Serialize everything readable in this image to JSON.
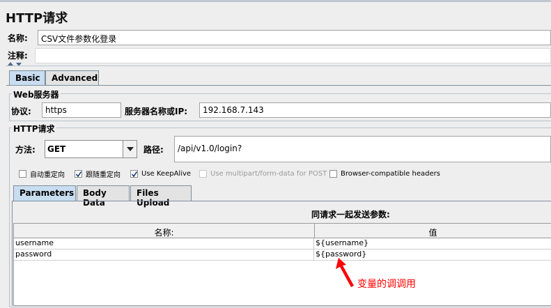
{
  "panel": {
    "title": "HTTP请求"
  },
  "name": {
    "label": "名称:",
    "value": "CSV文件参数化登录"
  },
  "comment": {
    "label": "注释:",
    "value": ""
  },
  "tabs": [
    {
      "label": "Basic",
      "active": true
    },
    {
      "label": "Advanced",
      "active": false
    }
  ],
  "web_server": {
    "title": "Web服务器",
    "protocol_label": "协议:",
    "protocol_value": "https",
    "server_label": "服务器名称或IP:",
    "server_value": "192.168.7.143"
  },
  "http_request": {
    "title": "HTTP请求",
    "method_label": "方法:",
    "method_value": "GET",
    "path_label": "路径:",
    "path_value": "/api/v1.0/login?"
  },
  "checkboxes": [
    {
      "label": "自动重定向",
      "checked": false,
      "enabled": true
    },
    {
      "label": "跟随重定向",
      "checked": true,
      "enabled": true
    },
    {
      "label": "Use KeepAlive",
      "checked": true,
      "enabled": true
    },
    {
      "label": "Use multipart/form-data for POST",
      "checked": false,
      "enabled": false
    },
    {
      "label": "Browser-compatible headers",
      "checked": false,
      "enabled": true
    }
  ],
  "subtabs": [
    {
      "label": "Parameters",
      "active": true
    },
    {
      "label": "Body Data",
      "active": false
    },
    {
      "label": "Files Upload",
      "active": false
    }
  ],
  "parameters": {
    "heading": "同请求一起发送参数:",
    "columns": [
      "名称:",
      "值"
    ],
    "rows": [
      {
        "name": "username",
        "value": "${username}"
      },
      {
        "name": "password",
        "value": "${password}"
      }
    ]
  },
  "annotation": {
    "text": "变量的调调用",
    "color": "#ff0000"
  },
  "colors": {
    "accent_tab": "#c9ddf1",
    "checkmark": "#1a3f7a"
  }
}
